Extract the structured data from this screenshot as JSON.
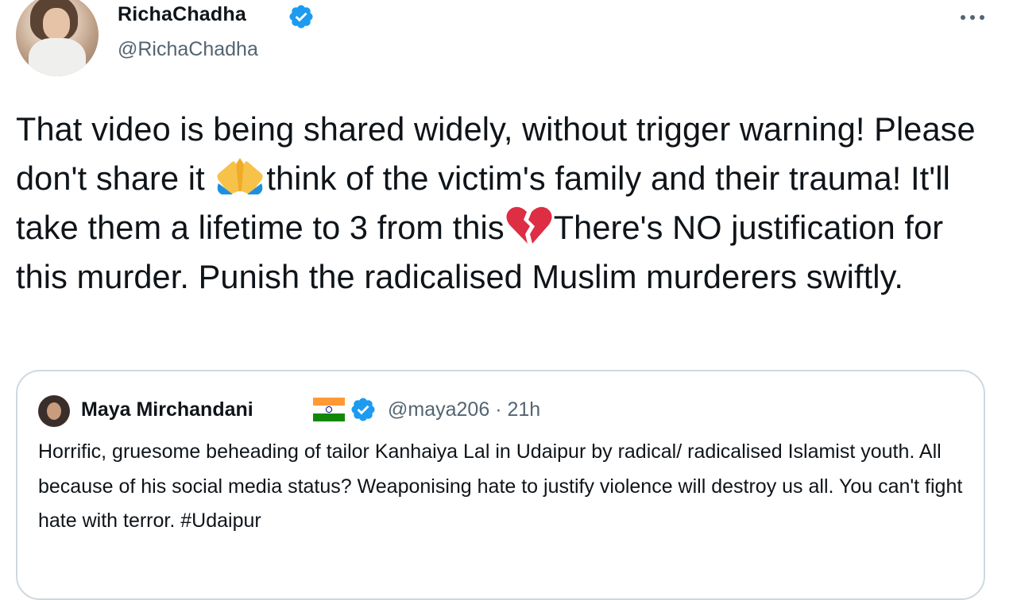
{
  "author": {
    "display_name": "RichaChadha",
    "handle": "@RichaChadha",
    "verified": true
  },
  "tweet": {
    "text_parts": [
      "That video is being shared widely, without trigger warning! Please  don't share it ",
      "think of the victim's family and their trauma! It'll take them a lifetime to 3 from this",
      "There's NO justification for this murder. Punish the radicalised Muslim murderers swiftly."
    ],
    "emojis": [
      "folded-hands",
      "broken-heart"
    ]
  },
  "quoted_tweet": {
    "display_name": "Maya Mirchandani",
    "flag": "india-flag",
    "verified": true,
    "handle": "@maya206",
    "separator": "·",
    "time": "21h",
    "text": "Horrific, gruesome beheading of tailor Kanhaiya Lal in Udaipur by radical/ radicalised Islamist youth. All because of his social media status? Weaponising hate to justify violence will destroy us all. You can't fight hate with terror. #Udaipur"
  },
  "colors": {
    "text": "#0f1419",
    "secondary": "#536471",
    "verified": "#1d9bf0",
    "border": "#cfd9de"
  }
}
